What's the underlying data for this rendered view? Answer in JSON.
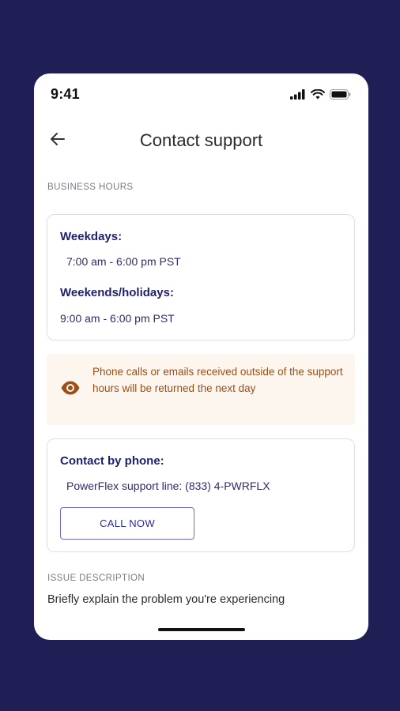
{
  "status_bar": {
    "time": "9:41"
  },
  "header": {
    "title": "Contact support"
  },
  "business_hours": {
    "section_label": "BUSINESS HOURS",
    "weekdays_heading": "Weekdays:",
    "weekdays_hours": "7:00 am - 6:00 pm PST",
    "weekends_heading": "Weekends/holidays:",
    "weekends_hours": "9:00 am - 6:00 pm PST"
  },
  "notice": {
    "text": "Phone calls or emails received outside of the support hours will be returned the next day",
    "icon": "eye-icon",
    "color": "#9a4f18"
  },
  "phone_contact": {
    "heading": "Contact by phone:",
    "line_text": "PowerFlex support line: (833) 4-PWRFLX",
    "call_button_label": "CALL NOW"
  },
  "issue": {
    "section_label": "ISSUE DESCRIPTION",
    "prompt_text": "Briefly explain the problem you're experiencing"
  },
  "colors": {
    "background": "#1f1f55",
    "accent": "#1f1f6e",
    "notice_bg": "#fdf6ef"
  }
}
